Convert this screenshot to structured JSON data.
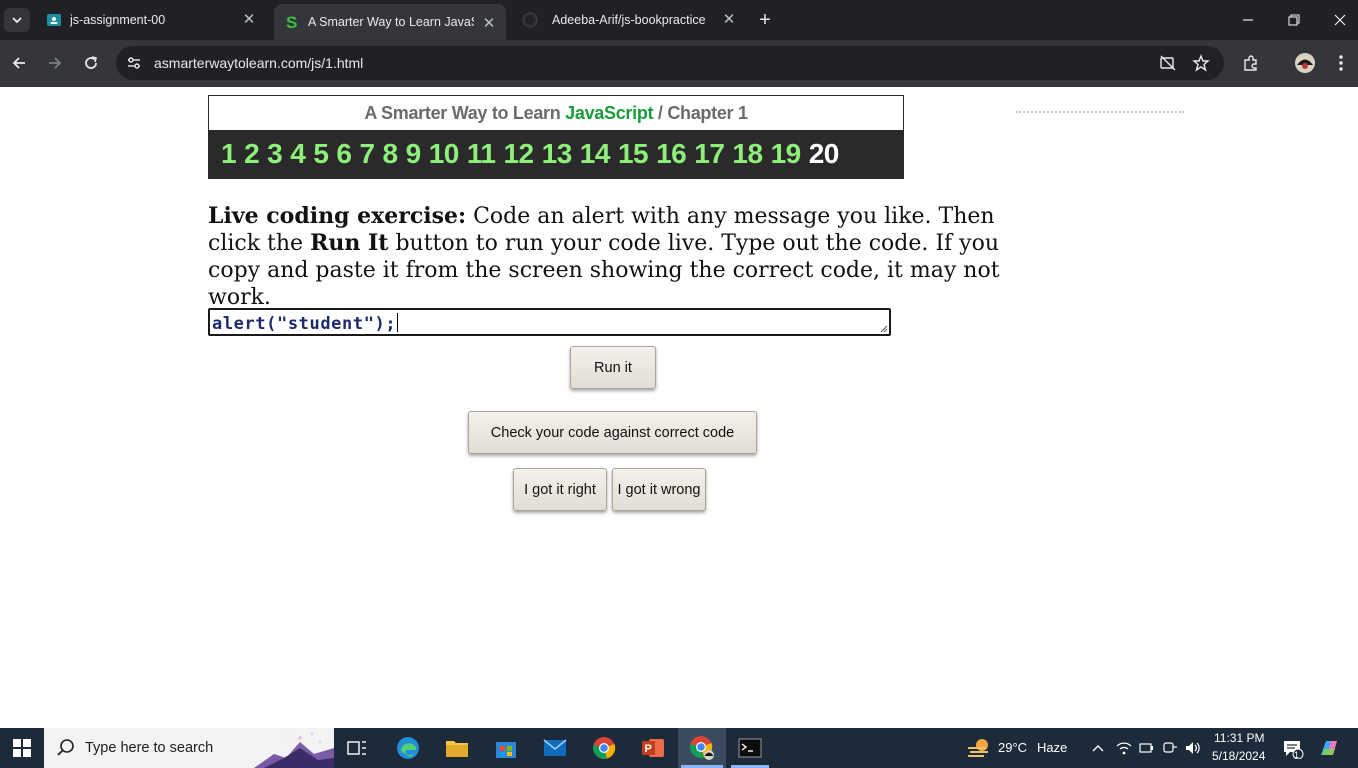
{
  "browser": {
    "tabs": [
      {
        "title": "js-assignment-00",
        "active": false,
        "icon": "classroom-icon"
      },
      {
        "title": "A Smarter Way to Learn JavaScr",
        "active": true,
        "icon": "smarter-way-icon"
      },
      {
        "title": "Adeeba-Arif/js-bookpractice",
        "active": false,
        "icon": "github-icon"
      }
    ],
    "url": "asmarterwaytolearn.com/js/1.html"
  },
  "page": {
    "header": {
      "prefix": "A Smarter Way to Learn ",
      "brand": "JavaScript",
      "separator": " / ",
      "chapter": "Chapter 1"
    },
    "exercise_numbers": [
      "1",
      "2",
      "3",
      "4",
      "5",
      "6",
      "7",
      "8",
      "9",
      "10",
      "11",
      "12",
      "13",
      "14",
      "15",
      "16",
      "17",
      "18",
      "19",
      "20"
    ],
    "current_exercise": "20",
    "instructions": {
      "lead": "Live coding exercise:",
      "part1": " Code an alert with any message you like. Then click the ",
      "run_bold": "Run It",
      "part2": " button to run your code live. Type out the code. If you copy and paste it from the screen showing the correct code, it may not work."
    },
    "code_input": "alert(\"student\");",
    "buttons": {
      "run": "Run it",
      "check": "Check your code against correct code",
      "right": "I got it right",
      "wrong": "I got it wrong"
    }
  },
  "taskbar": {
    "search_placeholder": "Type here to search",
    "weather": {
      "temp": "29°C",
      "condition": "Haze"
    },
    "time": "11:31 PM",
    "date": "5/18/2024",
    "notification_count": "1"
  },
  "colors": {
    "brand_green": "#1a9c3a",
    "number_green": "#8ef07a",
    "chrome_dark": "#202124",
    "chrome_toolbar": "#35363a"
  }
}
